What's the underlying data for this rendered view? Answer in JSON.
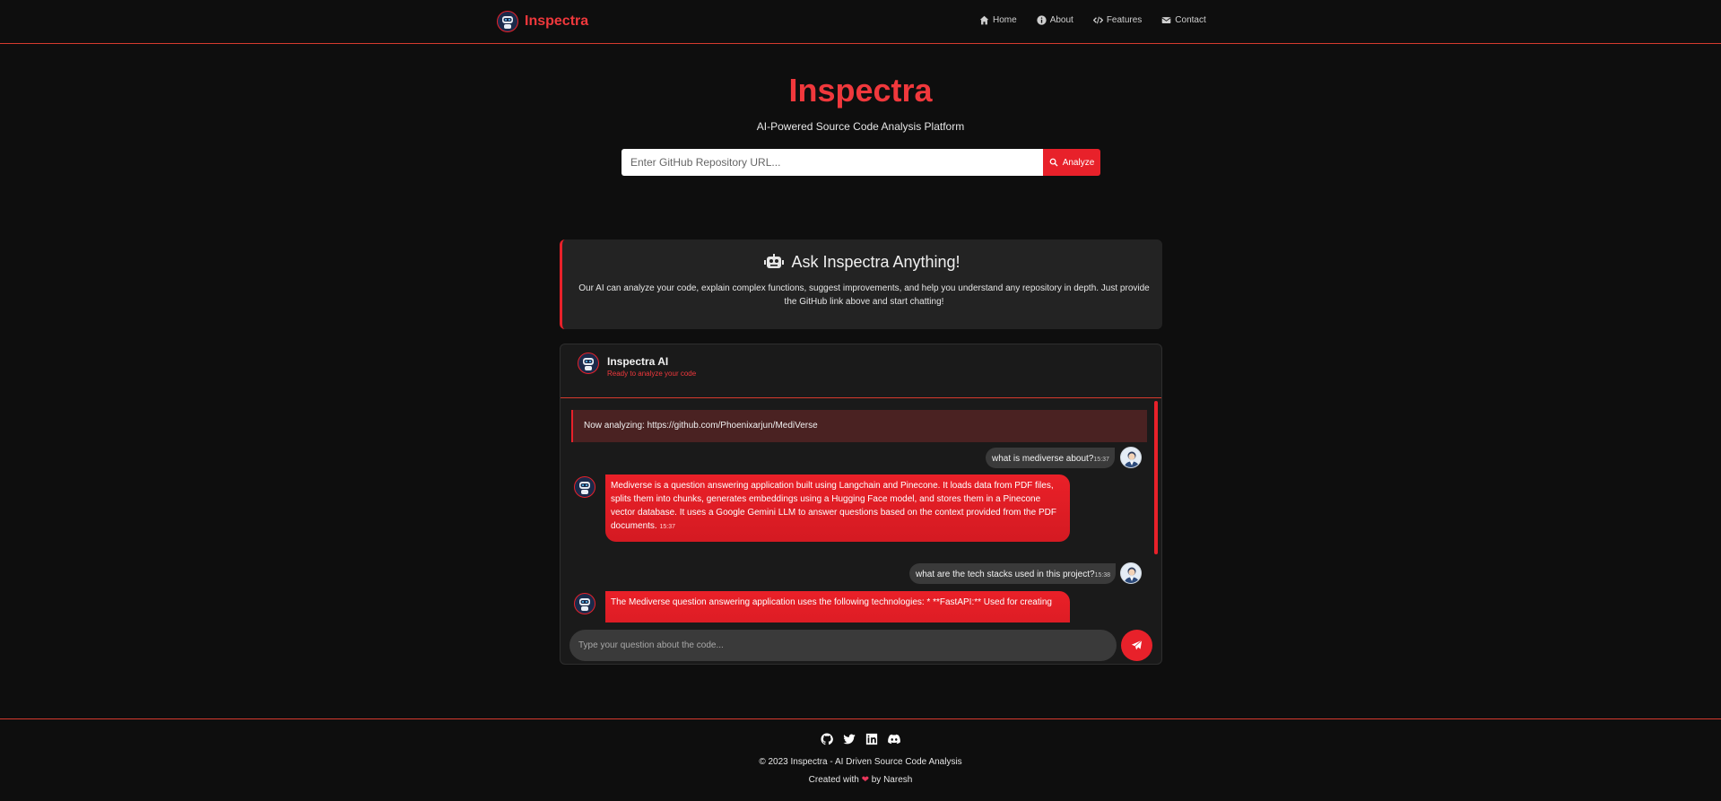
{
  "nav": {
    "brand": "Inspectra",
    "links": [
      {
        "label": "Home",
        "icon": "home-icon"
      },
      {
        "label": "About",
        "icon": "info-icon"
      },
      {
        "label": "Features",
        "icon": "code-icon"
      },
      {
        "label": "Contact",
        "icon": "envelope-icon"
      }
    ]
  },
  "hero": {
    "title": "Inspectra",
    "subtitle": "AI-Powered Source Code Analysis Platform",
    "search_placeholder": "Enter GitHub Repository URL...",
    "analyze_label": "Analyze"
  },
  "ask": {
    "title": "Ask Inspectra Anything!",
    "description": "Our AI can analyze your code, explain complex functions, suggest improvements, and help you understand any repository in depth. Just provide the GitHub link above and start chatting!"
  },
  "chat": {
    "name": "Inspectra AI",
    "status": "Ready to analyze your code",
    "analyzing_notice": "Now analyzing: https://github.com/Phoenixarjun/MediVerse",
    "messages": [
      {
        "role": "user",
        "text": "what is mediverse about?",
        "time": "15:37"
      },
      {
        "role": "bot",
        "text": "Mediverse is a question answering application built using Langchain and Pinecone. It loads data from PDF files, splits them into chunks, generates embeddings using a Hugging Face model, and stores them in a Pinecone vector database. It uses a Google Gemini LLM to answer questions based on the context provided from the PDF documents.",
        "time": "15:37"
      },
      {
        "role": "user",
        "text": "what are the tech stacks used in this project?",
        "time": "15:38"
      },
      {
        "role": "bot",
        "text": "The Mediverse question answering application uses the following technologies: * **FastAPI:** Used for creating",
        "time": ""
      }
    ],
    "input_placeholder": "Type your question about the code..."
  },
  "footer": {
    "social": [
      "github-icon",
      "twitter-icon",
      "linkedin-icon",
      "discord-icon"
    ],
    "copyright": "© 2023 Inspectra - AI Driven Source Code Analysis",
    "credit_prefix": "Created with",
    "credit_suffix": "by Naresh"
  },
  "colors": {
    "accent": "#e8212a",
    "brand_text": "#f0383c",
    "background": "#0e0e0e",
    "card": "#232323"
  }
}
